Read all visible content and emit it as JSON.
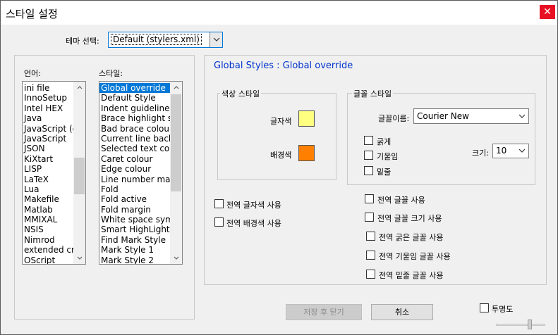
{
  "window": {
    "title": "스타일 설정",
    "close_glyph": "✕"
  },
  "theme": {
    "label": "테마 선택:",
    "value": "Default (stylers.xml)"
  },
  "languages": {
    "label": "언어:",
    "items": [
      "ini file",
      "InnoSetup",
      "Intel HEX",
      "Java",
      "JavaScript (en",
      "JavaScript",
      "JSON",
      "KiXtart",
      "LISP",
      "LaTeX",
      "Lua",
      "Makefile",
      "Matlab",
      "MMIXAL",
      "NSIS",
      "Nimrod",
      "extended cron",
      "OScript"
    ]
  },
  "styles": {
    "label": "스타일:",
    "selected_index": 0,
    "items": [
      "Global override",
      "Default Style",
      "Indent guideline st",
      "Brace highlight styl",
      "Bad brace colour",
      "Current line backgr",
      "Selected text colou",
      "Caret colour",
      "Edge colour",
      "Line number marg",
      "Fold",
      "Fold active",
      "Fold margin",
      "White space symbo",
      "Smart HighLighting",
      "Find Mark Style",
      "Mark Style 1",
      "Mark Style 2"
    ]
  },
  "panel": {
    "heading": "Global Styles : Global override"
  },
  "colour_style": {
    "title": "색상 스타일",
    "fg_label": "글자색",
    "fg_color": "#ffff80",
    "bg_label": "배경색",
    "bg_color": "#ff8000"
  },
  "font_style": {
    "title": "글꼴 스타일",
    "name_label": "글꼴이름:",
    "name_value": "Courier New",
    "bold_label": "굵게",
    "italic_label": "기울임",
    "underline_label": "밑줄",
    "size_label": "크기:",
    "size_value": "10"
  },
  "global_options": {
    "global_fg": "전역 글자색 사용",
    "global_bg": "전역 배경색 사용",
    "global_font": "전역 글꼴 사용",
    "global_font_size": "전역 글꼴 크기 사용",
    "global_bold": "전역 굵은 글꼴 사용",
    "global_italic": "전역 기울임 글꼴 사용",
    "global_underline": "전역 밑줄 글꼴 사용"
  },
  "buttons": {
    "save_close": "저장 후 닫기",
    "cancel": "취소"
  },
  "transparency": {
    "label": "투명도"
  },
  "icons": {
    "dropdown": "chevron-down-icon",
    "scroll_up": "scroll-up-icon",
    "scroll_down": "scroll-down-icon",
    "close": "close-icon"
  }
}
